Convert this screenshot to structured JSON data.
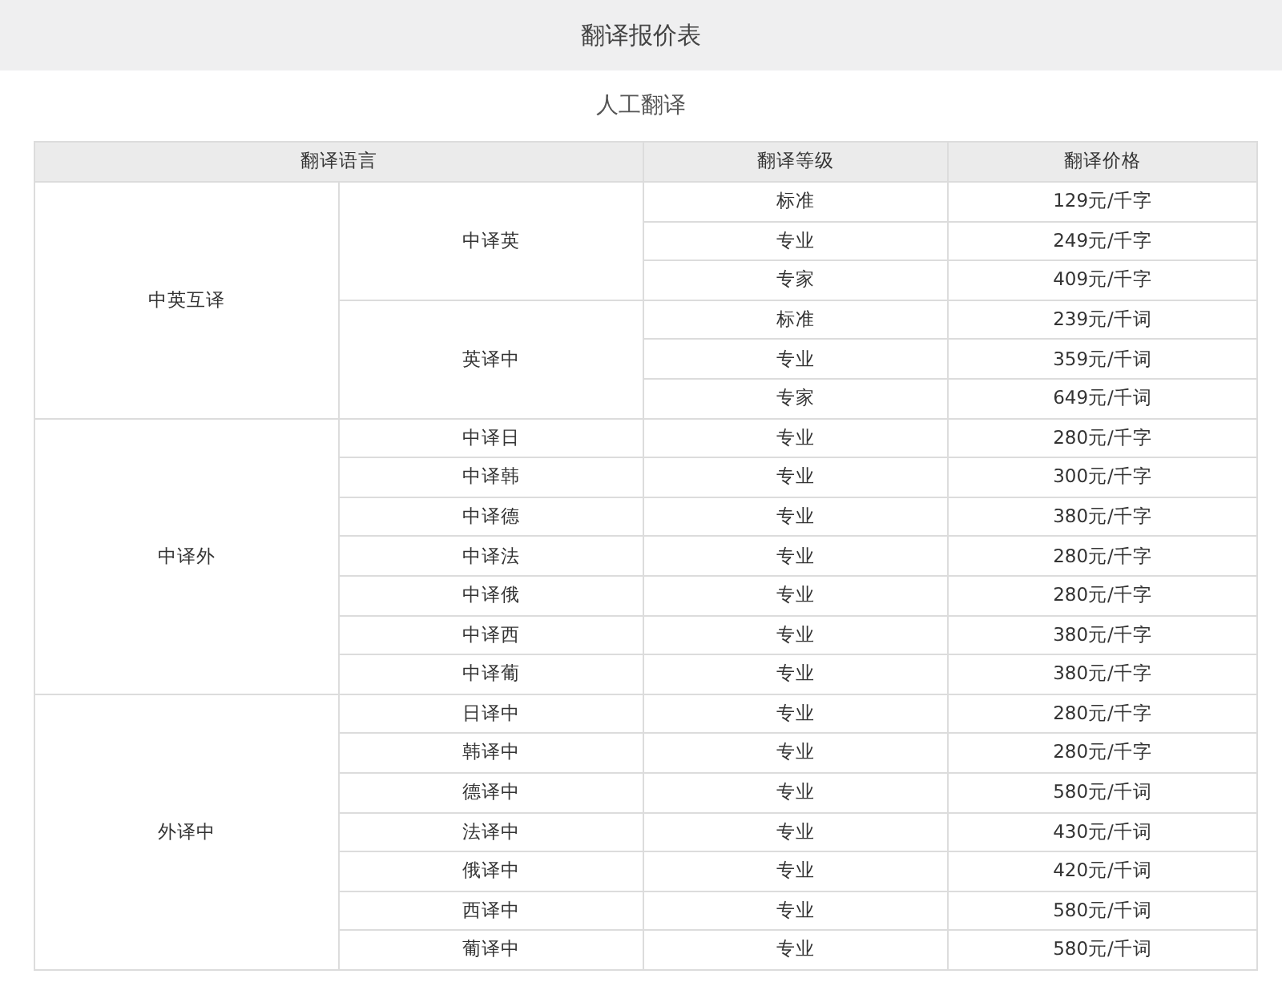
{
  "header": {
    "title": "翻译报价表"
  },
  "section_title": "人工翻译",
  "table": {
    "columns": [
      "翻译语言",
      "翻译等级",
      "翻译价格"
    ],
    "groups": [
      {
        "name": "中英互译",
        "pairs": [
          {
            "name": "中译英",
            "levels": [
              {
                "level": "标准",
                "price": "129元/千字"
              },
              {
                "level": "专业",
                "price": "249元/千字"
              },
              {
                "level": "专家",
                "price": "409元/千字"
              }
            ]
          },
          {
            "name": "英译中",
            "levels": [
              {
                "level": "标准",
                "price": "239元/千词"
              },
              {
                "level": "专业",
                "price": "359元/千词"
              },
              {
                "level": "专家",
                "price": "649元/千词"
              }
            ]
          }
        ]
      },
      {
        "name": "中译外",
        "pairs": [
          {
            "name": "中译日",
            "levels": [
              {
                "level": "专业",
                "price": "280元/千字"
              }
            ]
          },
          {
            "name": "中译韩",
            "levels": [
              {
                "level": "专业",
                "price": "300元/千字"
              }
            ]
          },
          {
            "name": "中译德",
            "levels": [
              {
                "level": "专业",
                "price": "380元/千字"
              }
            ]
          },
          {
            "name": "中译法",
            "levels": [
              {
                "level": "专业",
                "price": "280元/千字"
              }
            ]
          },
          {
            "name": "中译俄",
            "levels": [
              {
                "level": "专业",
                "price": "280元/千字"
              }
            ]
          },
          {
            "name": "中译西",
            "levels": [
              {
                "level": "专业",
                "price": "380元/千字"
              }
            ]
          },
          {
            "name": "中译葡",
            "levels": [
              {
                "level": "专业",
                "price": "380元/千字"
              }
            ]
          }
        ]
      },
      {
        "name": "外译中",
        "pairs": [
          {
            "name": "日译中",
            "levels": [
              {
                "level": "专业",
                "price": "280元/千字"
              }
            ]
          },
          {
            "name": "韩译中",
            "levels": [
              {
                "level": "专业",
                "price": "280元/千字"
              }
            ]
          },
          {
            "name": "德译中",
            "levels": [
              {
                "level": "专业",
                "price": "580元/千词"
              }
            ]
          },
          {
            "name": "法译中",
            "levels": [
              {
                "level": "专业",
                "price": "430元/千词"
              }
            ]
          },
          {
            "name": "俄译中",
            "levels": [
              {
                "level": "专业",
                "price": "420元/千词"
              }
            ]
          },
          {
            "name": "西译中",
            "levels": [
              {
                "level": "专业",
                "price": "580元/千词"
              }
            ]
          },
          {
            "name": "葡译中",
            "levels": [
              {
                "level": "专业",
                "price": "580元/千词"
              }
            ]
          }
        ]
      }
    ]
  }
}
